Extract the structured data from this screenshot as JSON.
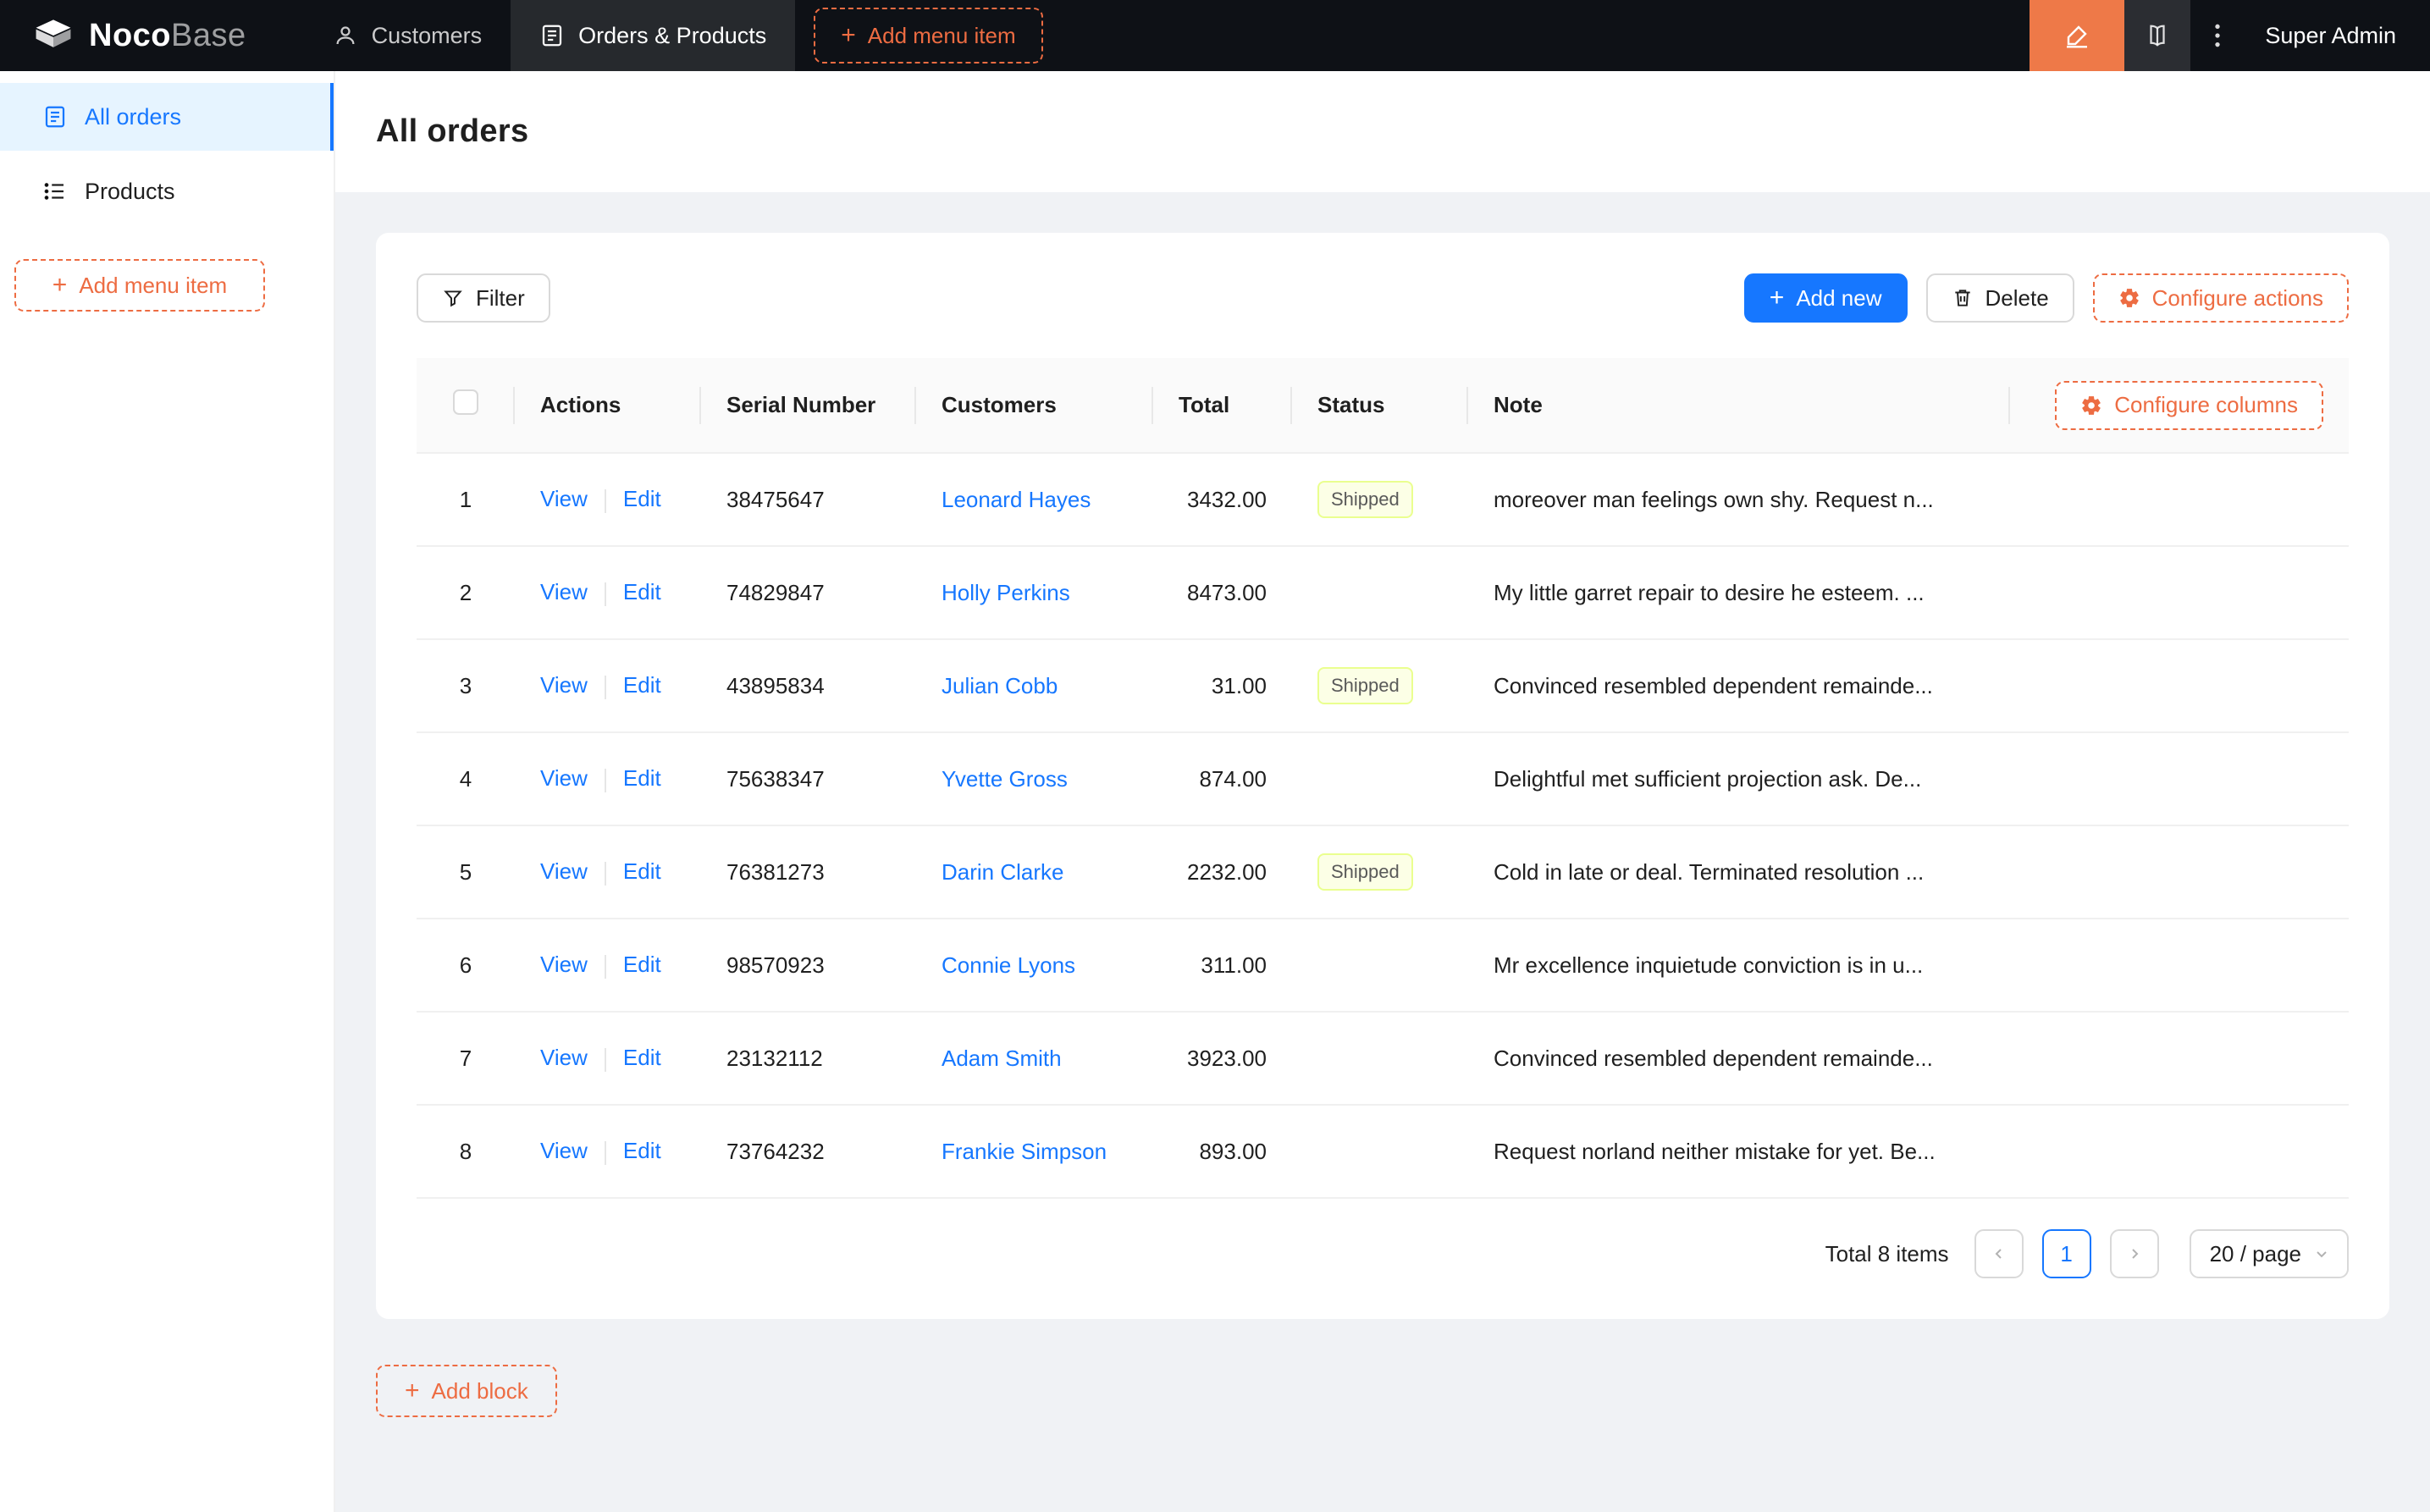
{
  "nav": {
    "brand": {
      "noco": "Noco",
      "base": "Base"
    },
    "items": [
      {
        "label": "Customers"
      },
      {
        "label": "Orders & Products"
      }
    ],
    "add_menu_item": "Add menu item",
    "user": "Super Admin"
  },
  "sidebar": {
    "items": [
      {
        "label": "All orders"
      },
      {
        "label": "Products"
      }
    ],
    "add_menu_item": "Add menu item"
  },
  "page": {
    "title": "All orders"
  },
  "toolbar": {
    "filter": "Filter",
    "add_new": "Add new",
    "delete": "Delete",
    "configure_actions": "Configure actions"
  },
  "table": {
    "columns": [
      "Actions",
      "Serial Number",
      "Customers",
      "Total",
      "Status",
      "Note"
    ],
    "configure_columns": "Configure columns",
    "actions": {
      "view": "View",
      "edit": "Edit"
    },
    "rows": [
      {
        "index": "1",
        "serial": "38475647",
        "customer": "Leonard Hayes",
        "total": "3432.00",
        "status": "Shipped",
        "note": "moreover man feelings own shy. Request n..."
      },
      {
        "index": "2",
        "serial": "74829847",
        "customer": "Holly Perkins",
        "total": "8473.00",
        "status": "",
        "note": "My little garret repair to desire he esteem. ..."
      },
      {
        "index": "3",
        "serial": "43895834",
        "customer": "Julian Cobb",
        "total": "31.00",
        "status": "Shipped",
        "note": "Convinced resembled dependent remainde..."
      },
      {
        "index": "4",
        "serial": "75638347",
        "customer": "Yvette Gross",
        "total": "874.00",
        "status": "",
        "note": "Delightful met sufficient projection ask. De..."
      },
      {
        "index": "5",
        "serial": "76381273",
        "customer": "Darin Clarke",
        "total": "2232.00",
        "status": "Shipped",
        "note": "Cold in late or deal. Terminated resolution ..."
      },
      {
        "index": "6",
        "serial": "98570923",
        "customer": "Connie Lyons",
        "total": "311.00",
        "status": "",
        "note": "Mr excellence inquietude conviction is in u..."
      },
      {
        "index": "7",
        "serial": "23132112",
        "customer": "Adam Smith",
        "total": "3923.00",
        "status": "",
        "note": "Convinced resembled dependent remainde..."
      },
      {
        "index": "8",
        "serial": "73764232",
        "customer": "Frankie Simpson",
        "total": "893.00",
        "status": "",
        "note": "Request norland neither mistake for yet. Be..."
      }
    ]
  },
  "pagination": {
    "total": "Total 8 items",
    "page": "1",
    "page_size": "20 / page"
  },
  "add_block": "Add block",
  "icons": {
    "nocobase-logo": "cube mark",
    "customers-icon": "person outline",
    "orders-icon": "document with lines",
    "products-icon": "bulleted list",
    "designer-icon": "highlighter pen",
    "book-icon": "open book",
    "more-icon": "vertical ellipsis",
    "plus-icon": "+",
    "filter-icon": "funnel",
    "delete-icon": "trash can",
    "gear-icon": "gear",
    "chevron-left-icon": "‹",
    "chevron-right-icon": "›",
    "chevron-down-icon": "⌄"
  },
  "colors": {
    "accent_orange": "#ED6C42",
    "designer_orange": "#EE7948",
    "primary_blue": "#1677FF",
    "nav_bg": "#0E1116",
    "sidebar_active_bg": "#E6F4FF",
    "tag_bg": "#FCFFE6",
    "tag_border": "#EAFF8F",
    "page_bg": "#F0F2F5"
  }
}
